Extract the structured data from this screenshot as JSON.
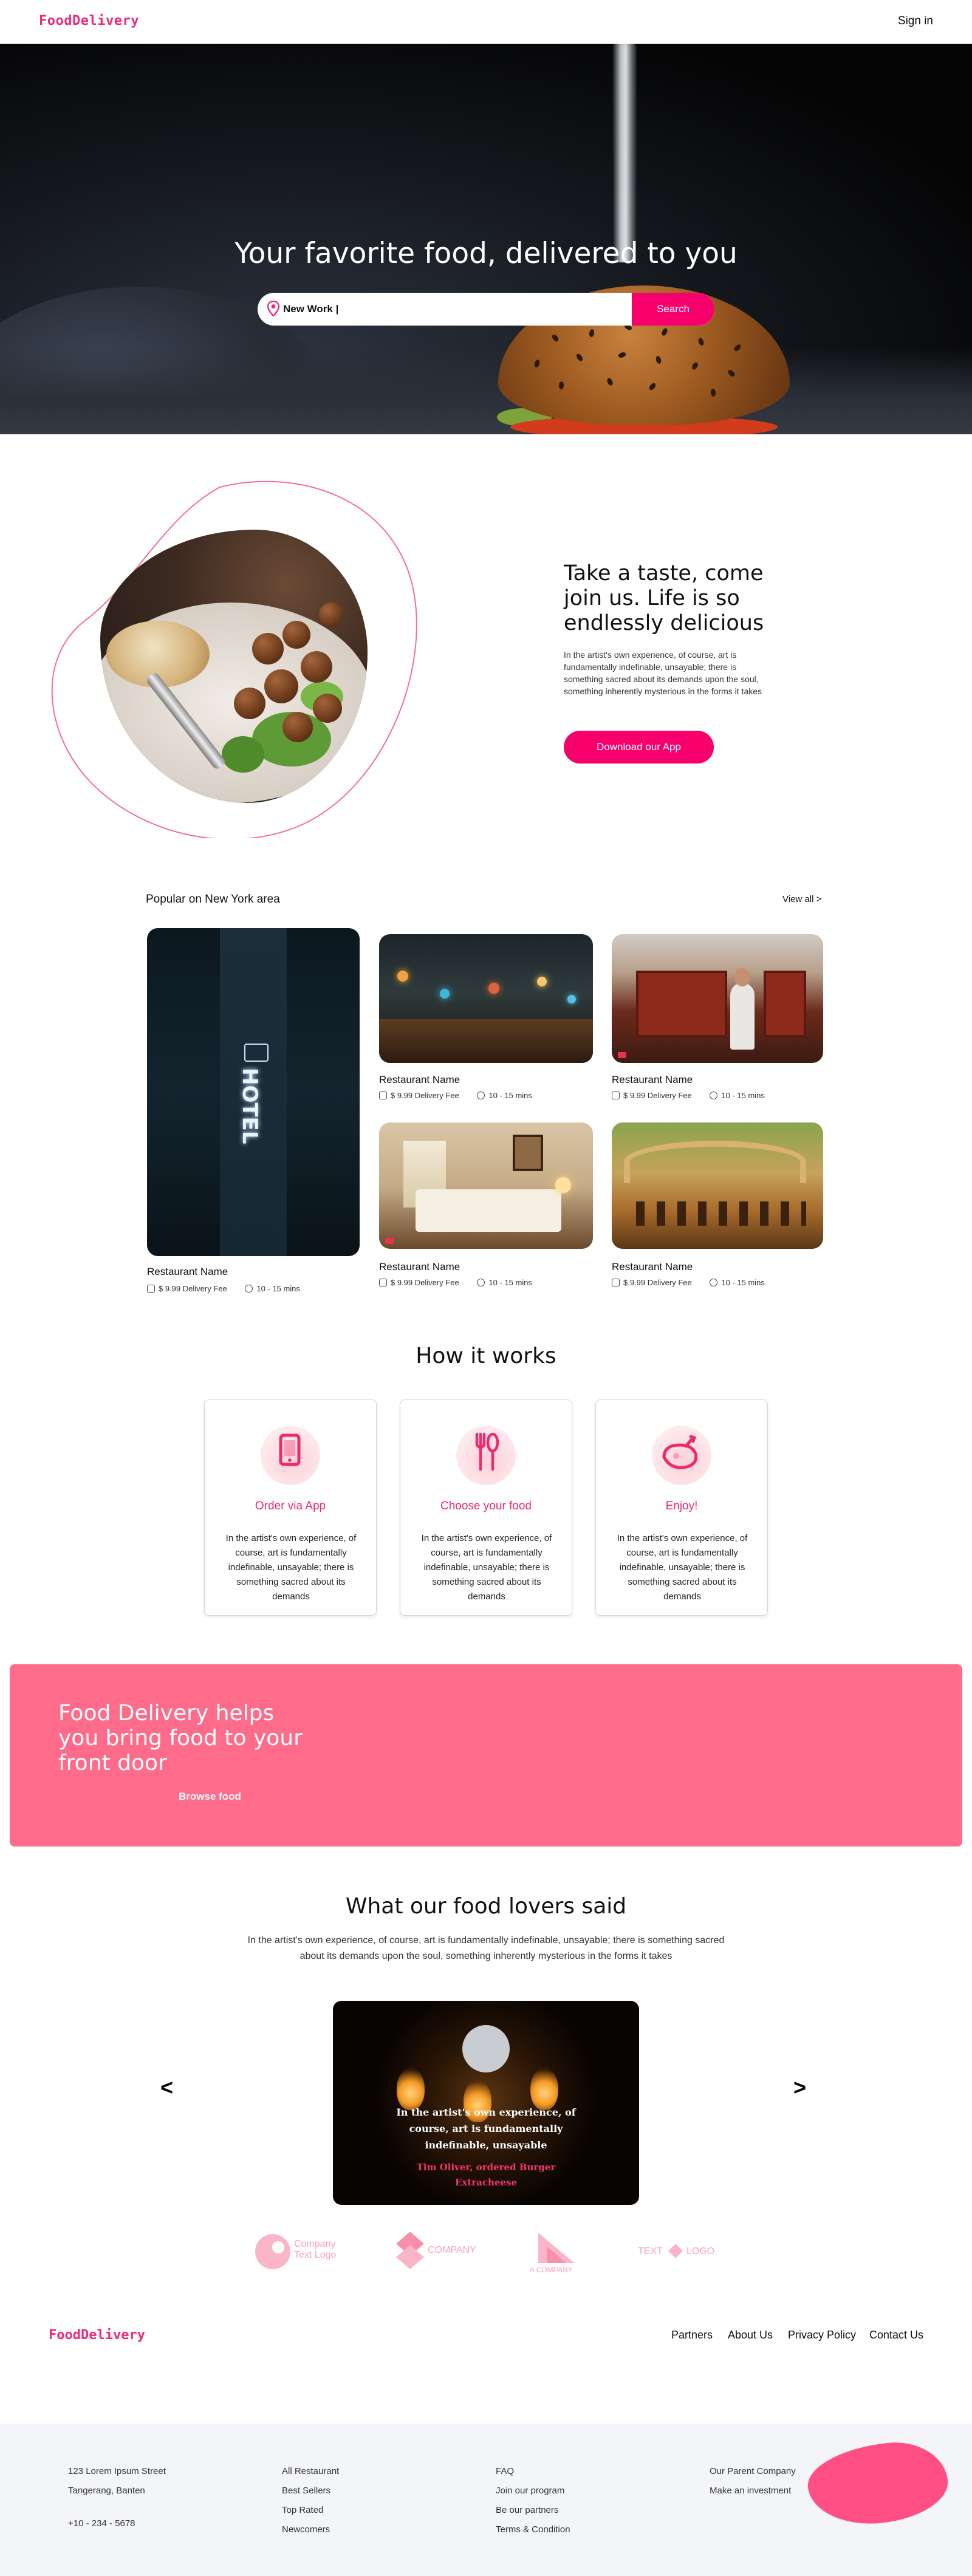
{
  "header": {
    "brand": "FoodDelivery",
    "signin": "Sign in"
  },
  "hero": {
    "title": "Your favorite food, delivered to you",
    "search_value": "New Work |",
    "search_button": "Search"
  },
  "intro": {
    "title": "Take a taste, come join us. Life is so endlessly delicious",
    "text": "In the artist's own experience, of course, art is fundamentally indefinable, unsayable; there is something sacred about its demands upon the soul, something inherently mysterious in the forms it takes",
    "button": "Download our App"
  },
  "popular": {
    "title": "Popular on New York area",
    "view_all": "View all >",
    "restaurants": [
      {
        "name": "Restaurant Name",
        "fee": "$ 9.99 Delivery Fee",
        "time": "10 - 15 mins"
      },
      {
        "name": "Restaurant Name",
        "fee": "$ 9.99 Delivery Fee",
        "time": "10 - 15 mins"
      },
      {
        "name": "Restaurant Name",
        "fee": "$ 9.99 Delivery Fee",
        "time": "10 - 15 mins"
      },
      {
        "name": "Restaurant Name",
        "fee": "$ 9.99 Delivery Fee",
        "time": "10 - 15 mins"
      },
      {
        "name": "Restaurant Name",
        "fee": "$ 9.99 Delivery Fee",
        "time": "10 - 15 mins"
      }
    ],
    "hotel_sign": "HOTEL"
  },
  "how": {
    "title": "How it works",
    "steps": [
      {
        "title": "Order via App",
        "text": "In the artist's own experience, of course, art is fundamentally indefinable, unsayable; there is something sacred about its demands",
        "icon": "smartphone-icon"
      },
      {
        "title": "Choose your food",
        "text": "In the artist's own experience, of course, art is fundamentally indefinable, unsayable; there is something sacred about its demands",
        "icon": "fork-spoon-icon"
      },
      {
        "title": "Enjoy!",
        "text": "In the artist's own experience, of course, art is fundamentally indefinable, unsayable; there is something sacred about its demands",
        "icon": "roast-chicken-icon"
      }
    ]
  },
  "banner": {
    "title": "Food Delivery helps you bring food to your front door",
    "link": "Browse food"
  },
  "testimonials": {
    "title": "What our food lovers said",
    "text": "In the artist's own experience, of course, art is fundamentally indefinable, unsayable; there is something sacred about its demands upon the soul, something inherently mysterious in the forms it takes",
    "quote": "In the artist's own experience, of course, art is fundamentally indefinable, unsayable",
    "author": "Tim Oliver, ordered Burger Extracheese",
    "prev": "<",
    "next": ">"
  },
  "logos": [
    {
      "line1": "Company",
      "line2": "Text Logo"
    },
    {
      "line1": "COMPANY",
      "line2": ""
    },
    {
      "line1": "A COMPANY",
      "line2": ""
    },
    {
      "line1": "TEXT",
      "line2": "LOGO"
    }
  ],
  "footer_nav": {
    "brand": "FoodDelivery",
    "links": [
      "Partners",
      "About Us",
      "Privacy Policy",
      "Contact Us"
    ]
  },
  "footer": {
    "address": [
      "123 Lorem Ipsum Street",
      "Tangerang, Banten"
    ],
    "phone": "+10 - 234 - 5678",
    "col2": [
      "All Restaurant",
      "Best Sellers",
      "Top Rated",
      "Newcomers"
    ],
    "col3": [
      "FAQ",
      "Join our program",
      "Be our partners",
      "Terms & Condition"
    ],
    "col4": [
      "Our Parent Company",
      "Make an investment"
    ]
  },
  "colors": {
    "accent": "#f7006d",
    "banner": "#ff6b8b",
    "brand": "#ee2a7b",
    "footer_bg": "#f4f5f8"
  }
}
